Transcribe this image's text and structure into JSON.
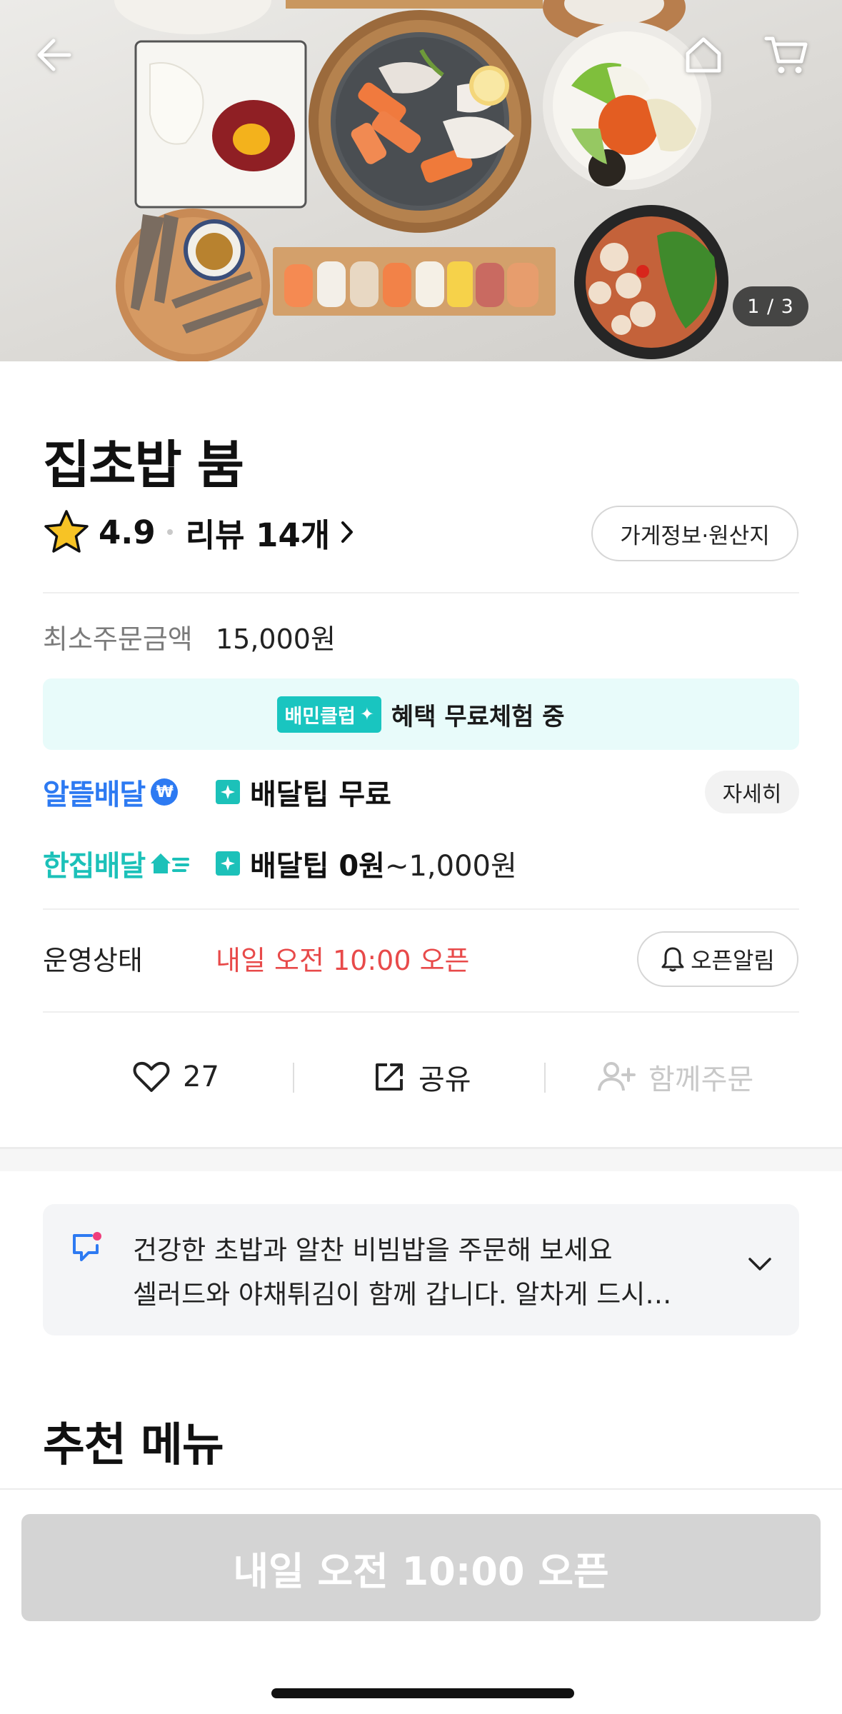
{
  "hero": {
    "photo_description_icon": "food-photo",
    "counter": "1 / 3"
  },
  "store": {
    "name": "집초밥 붐",
    "rating": "4.9",
    "review_link": "리뷰 14개",
    "info_button": "가게정보·원산지"
  },
  "order": {
    "min_order_label": "최소주문금액",
    "min_order_value": "15,000원"
  },
  "club_banner": {
    "badge": "배민클럽",
    "text": "혜택 무료체험 중",
    "color": "#19c5c0"
  },
  "delivery": {
    "options": [
      {
        "type": "알뜰배달",
        "badge": "₩",
        "tip_strong": "배달팁 무료",
        "tip_normal": ""
      },
      {
        "type": "한집배달",
        "badge": "",
        "tip_strong": "배달팁 0원",
        "tip_normal": "~1,000원"
      }
    ],
    "detail_button": "자세히"
  },
  "status": {
    "label": "운영상태",
    "value": "내일 오전 10:00 오픈",
    "value_color": "#e84a4a",
    "alarm_button": "오픈알림"
  },
  "actions": {
    "like_count": "27",
    "share_label": "공유",
    "group_order_label": "함께주문"
  },
  "notice": {
    "line1": "건강한 초밥과 알찬 비빔밥을 주문해 보세요",
    "line2": "셀러드와 야채튀김이 함께 갑니다.  알차게 드시…"
  },
  "recommended": {
    "title": "추천 메뉴"
  },
  "cta": {
    "label": "내일 오전 10:00 오픈"
  }
}
